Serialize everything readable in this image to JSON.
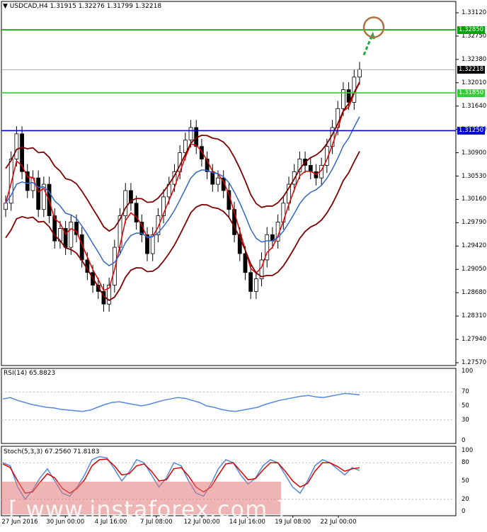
{
  "header": {
    "triangle": "▼",
    "title": "USDCAD,H4  1.31915 1.32276 1.31799 1.32218"
  },
  "rsi": {
    "label": "RSI(14) 65.8823"
  },
  "stoch": {
    "label": "Stoch(5,3,3) 67.2560 71.8183"
  },
  "watermark": "[ www.instaforex.com ]",
  "colors": {
    "bull_candle": "#000000",
    "bear_candle": "#000000",
    "bollinger": "#7f0000",
    "ema_fast": "#e00000",
    "ema_slow": "#3366cc",
    "resistance_line": "#00a000",
    "support_line_1": "#33cc33",
    "support_line_2": "#0000cc",
    "arrow": "#22aa44",
    "circle": "#b07040",
    "rsi_line": "#5588dd",
    "stoch_main": "#5588dd",
    "stoch_signal": "#dd0000"
  },
  "chart_data": [
    {
      "type": "line",
      "panel": "price",
      "title": "USDCAD,H4",
      "ylim": [
        1.2757,
        1.3312
      ],
      "y_ticks": [
        "1.33120",
        "1.32750",
        "1.32380",
        "1.32010",
        "1.31640",
        "1.31270",
        "1.30900",
        "1.30530",
        "1.30160",
        "1.29790",
        "1.29420",
        "1.29050",
        "1.28680",
        "1.28310",
        "1.27940",
        "1.27570"
      ],
      "x_ticks": [
        "27 Jun 2016",
        "30 Jun 00:00",
        "4 Jul 16:00",
        "7 Jul 08:00",
        "12 Jul 00:00",
        "14 Jul 16:00",
        "19 Jul 08:00",
        "22 Jul 00:00"
      ],
      "ohlc_last": {
        "open": 1.31915,
        "high": 1.32276,
        "low": 1.31799,
        "close": 1.32218
      },
      "horizontal_levels": [
        {
          "value": 1.3285,
          "label": "1.32850",
          "color": "#00a000"
        },
        {
          "value": 1.3185,
          "label": "1.31850",
          "color": "#33cc33"
        },
        {
          "value": 1.3125,
          "label": "1.31250",
          "color": "#0000cc"
        }
      ],
      "current_price_label": "1.32218",
      "series": [
        {
          "name": "close",
          "values": [
            1.301,
            1.308,
            1.312,
            1.306,
            1.303,
            1.305,
            1.3,
            1.304,
            1.299,
            1.295,
            1.297,
            1.294,
            1.298,
            1.296,
            1.292,
            1.29,
            1.288,
            1.287,
            1.285,
            1.288,
            1.294,
            1.299,
            1.303,
            1.301,
            1.298,
            1.296,
            1.293,
            1.296,
            1.299,
            1.302,
            1.304,
            1.306,
            1.309,
            1.311,
            1.313,
            1.31,
            1.308,
            1.306,
            1.304,
            1.305,
            1.303,
            1.3,
            1.296,
            1.293,
            1.29,
            1.287,
            1.289,
            1.292,
            1.296,
            1.295,
            1.298,
            1.301,
            1.304,
            1.306,
            1.308,
            1.307,
            1.306,
            1.305,
            1.307,
            1.31,
            1.313,
            1.316,
            1.319,
            1.317,
            1.321,
            1.3222
          ]
        }
      ]
    },
    {
      "type": "line",
      "panel": "rsi",
      "ylim": [
        0,
        100
      ],
      "y_ticks": [
        "100",
        "70",
        "50",
        "30",
        "0"
      ],
      "series": [
        {
          "name": "RSI(14)",
          "values": [
            60,
            62,
            58,
            55,
            52,
            50,
            48,
            47,
            45,
            44,
            43,
            42,
            44,
            48,
            52,
            55,
            56,
            54,
            52,
            50,
            52,
            55,
            58,
            60,
            62,
            61,
            58,
            55,
            50,
            48,
            45,
            43,
            42,
            44,
            46,
            48,
            52,
            55,
            58,
            60,
            62,
            64,
            65,
            63,
            62,
            64,
            66,
            68,
            67,
            65.88
          ]
        }
      ]
    },
    {
      "type": "line",
      "panel": "stoch",
      "ylim": [
        0,
        100
      ],
      "y_ticks": [
        "100",
        "80",
        "50",
        "20",
        "0"
      ],
      "series": [
        {
          "name": "Stoch main",
          "values": [
            80,
            75,
            40,
            20,
            35,
            55,
            70,
            50,
            30,
            25,
            40,
            60,
            85,
            90,
            88,
            70,
            50,
            65,
            85,
            80,
            60,
            40,
            55,
            80,
            75,
            50,
            30,
            25,
            45,
            70,
            85,
            80,
            60,
            45,
            55,
            75,
            85,
            80,
            60,
            40,
            30,
            50,
            75,
            85,
            80,
            70,
            60,
            72,
            67.26
          ]
        },
        {
          "name": "Stoch signal",
          "values": [
            78,
            72,
            50,
            30,
            32,
            48,
            62,
            55,
            38,
            30,
            38,
            52,
            75,
            85,
            86,
            75,
            60,
            62,
            75,
            78,
            66,
            50,
            52,
            70,
            72,
            58,
            40,
            32,
            40,
            60,
            78,
            80,
            66,
            52,
            54,
            68,
            80,
            80,
            66,
            50,
            40,
            46,
            66,
            80,
            80,
            74,
            66,
            70,
            71.82
          ]
        }
      ]
    }
  ]
}
